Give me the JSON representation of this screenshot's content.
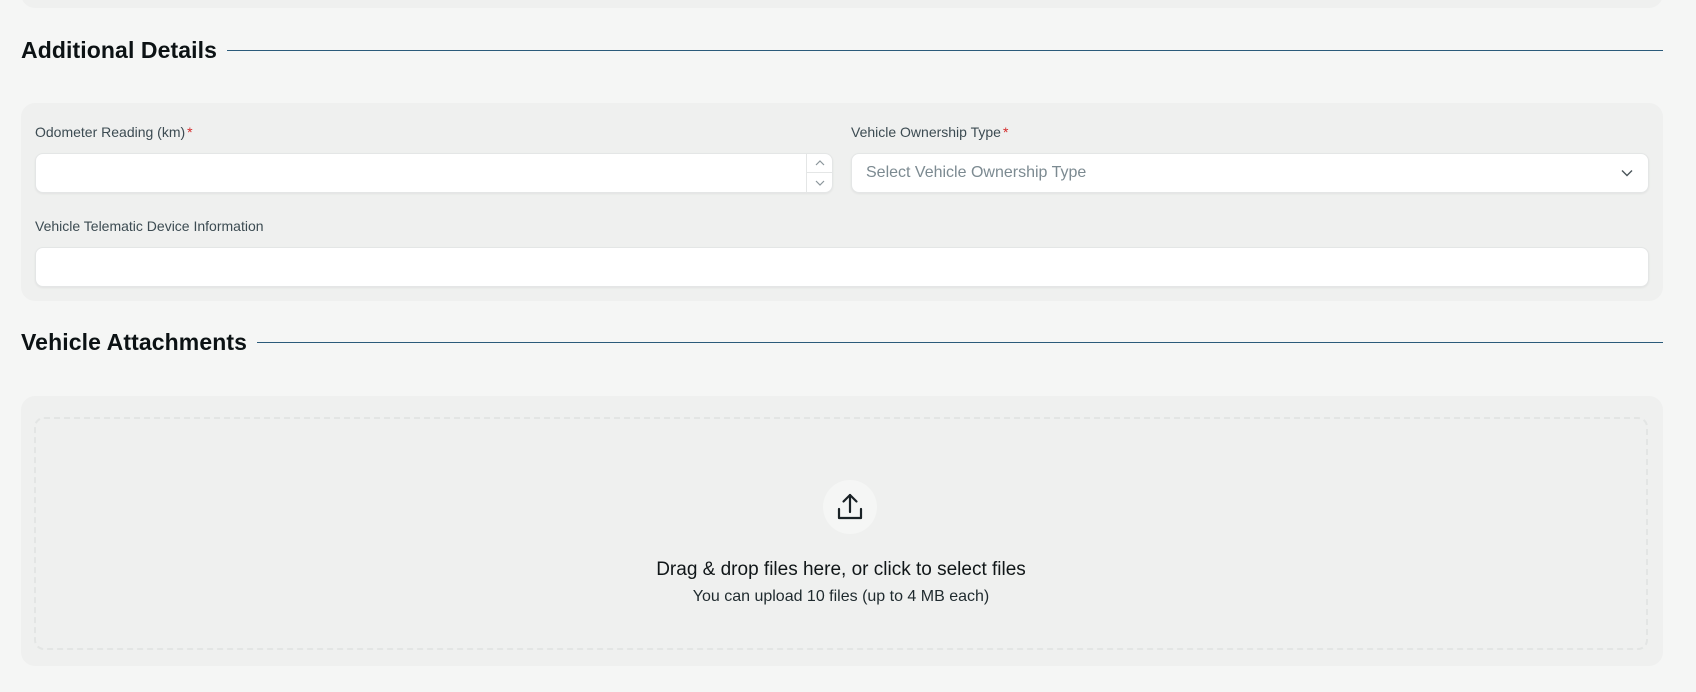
{
  "additional_details": {
    "heading": "Additional Details",
    "odometer": {
      "label": "Odometer Reading (km)",
      "required_marker": "*",
      "value": ""
    },
    "ownership_type": {
      "label": "Vehicle Ownership Type",
      "required_marker": "*",
      "placeholder": "Select Vehicle Ownership Type"
    },
    "telematic": {
      "label": "Vehicle Telematic Device Information",
      "value": ""
    }
  },
  "attachments": {
    "heading": "Vehicle Attachments",
    "dropzone_title": "Drag & drop files here, or click to select files",
    "dropzone_subtitle": "You can upload 10 files (up to 4 MB each)",
    "icon": "upload-icon"
  },
  "colors": {
    "section_rule": "#2b5b7a",
    "required": "#d42a2a",
    "card_background": "#eff0ef",
    "page_background": "#f5f6f5"
  }
}
